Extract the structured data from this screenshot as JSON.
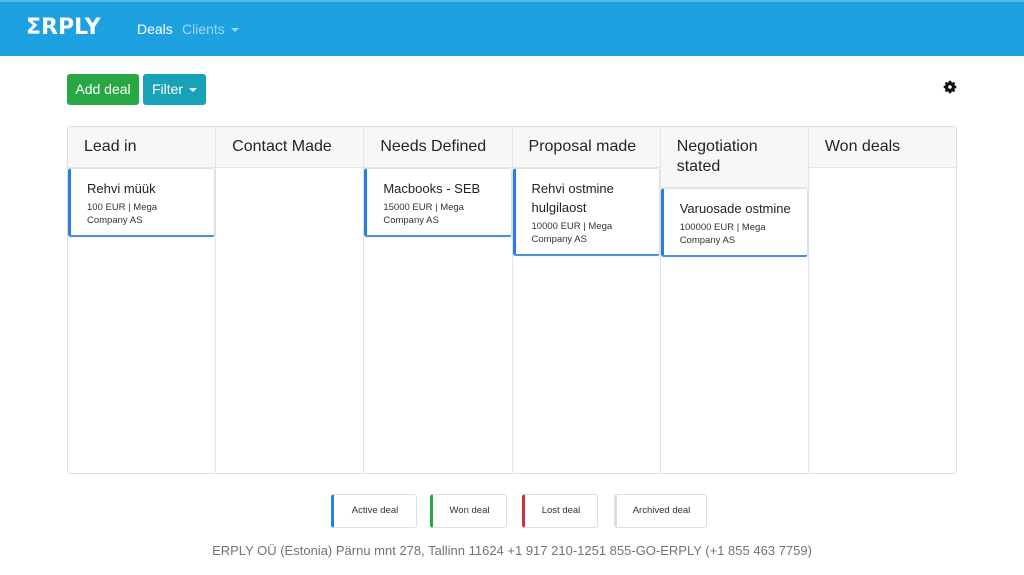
{
  "header": {
    "logo": "ΣRPLY",
    "nav": [
      {
        "label": "Deals"
      },
      {
        "label": "Clients"
      }
    ]
  },
  "toolbar": {
    "add_deal_label": "Add deal",
    "filter_label": "Filter",
    "settings_icon": "gear-icon"
  },
  "board": {
    "columns": [
      {
        "title": "Lead in",
        "cards": [
          {
            "title": "Rehvi müük",
            "sub": "100 EUR | Mega Company AS"
          }
        ]
      },
      {
        "title": "Contact Made",
        "cards": []
      },
      {
        "title": "Needs Defined",
        "cards": [
          {
            "title": "Macbooks - SEB",
            "sub": "15000 EUR | Mega Company AS"
          }
        ]
      },
      {
        "title": "Proposal made",
        "cards": [
          {
            "title": "Rehvi ostmine hulgilaost",
            "sub": "10000 EUR | Mega Company AS"
          }
        ]
      },
      {
        "title": "Negotiation stated",
        "cards": [
          {
            "title": "Varuosade ostmine",
            "sub": "100000 EUR | Mega Company AS"
          }
        ]
      },
      {
        "title": "Won deals",
        "cards": []
      }
    ]
  },
  "legend": {
    "active": "Active deal",
    "won": "Won deal",
    "lost": "Lost deal",
    "archived": "Archived deal"
  },
  "colors": {
    "brand": "#1ea1e0",
    "active": "#2c7ce0",
    "won": "#28a745",
    "lost": "#c8343f",
    "archived": "#dddddd"
  },
  "footer": {
    "text": "ERPLY OÜ (Estonia) Pärnu mnt 278, Tallinn 11624 +1 917 210-1251 855-GO-ERPLY (+1 855 463 7759)"
  }
}
